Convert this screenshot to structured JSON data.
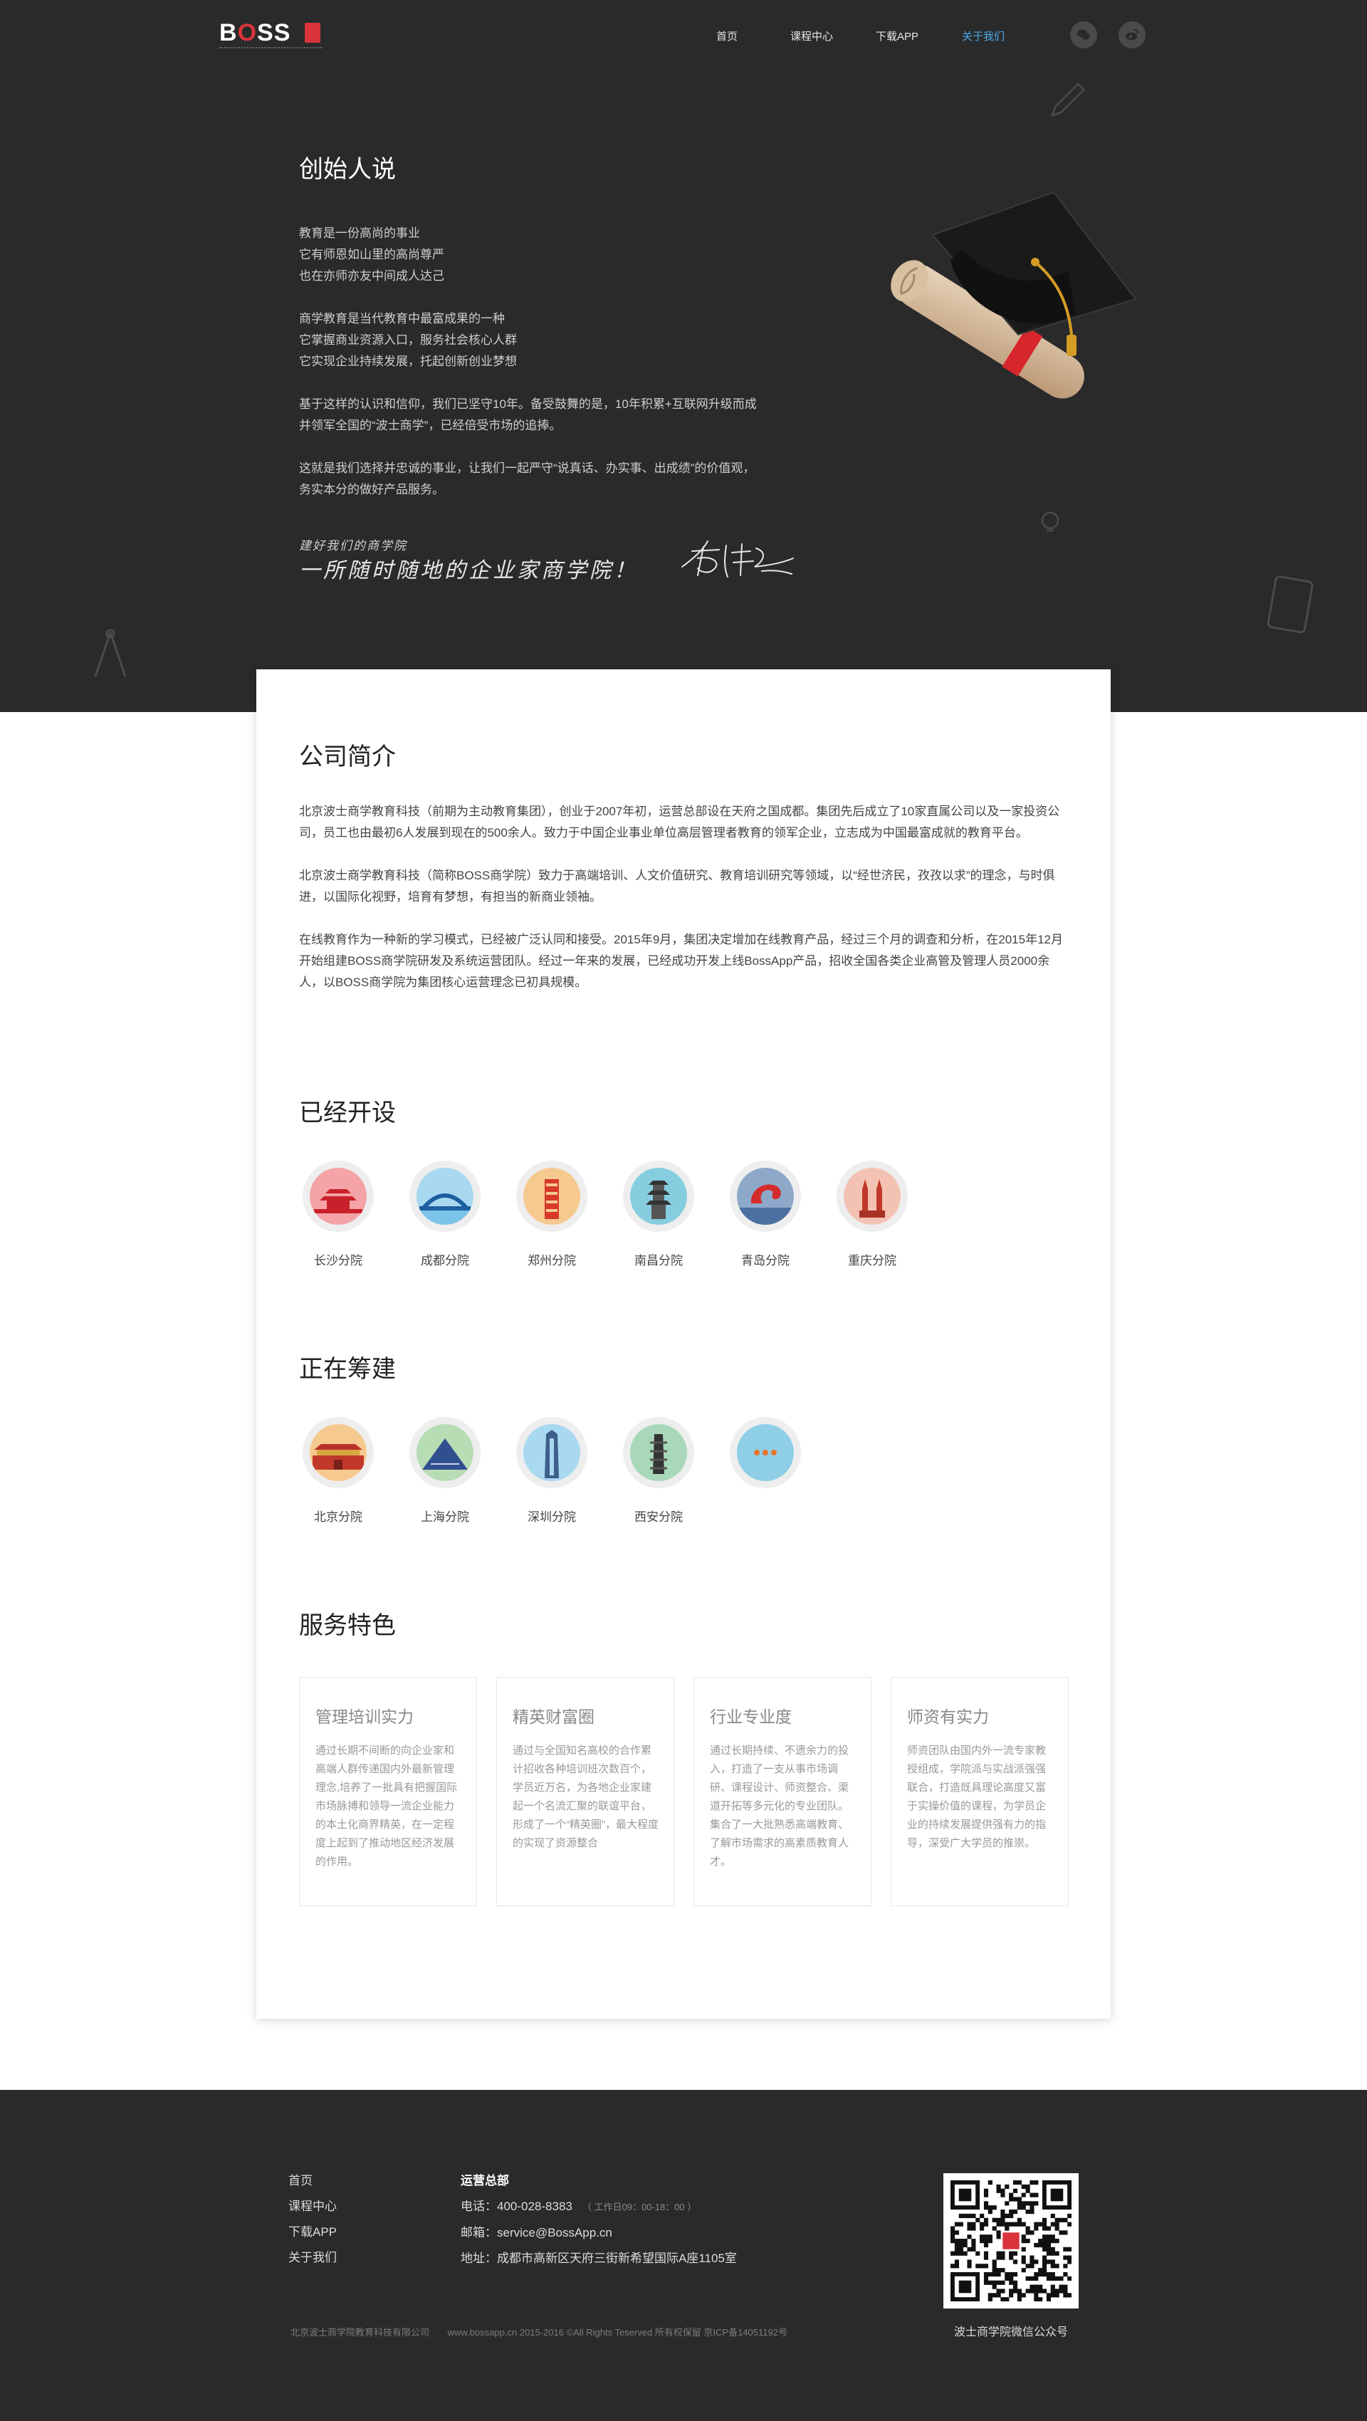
{
  "header": {
    "logo_text": "BOSS",
    "nav": [
      {
        "label": "首页",
        "active": false
      },
      {
        "label": "课程中心",
        "active": false
      },
      {
        "label": "下载APP",
        "active": false
      },
      {
        "label": "关于我们",
        "active": true
      }
    ],
    "social": [
      "wechat-icon",
      "weibo-icon"
    ]
  },
  "founder": {
    "title": "创始人说",
    "paragraphs": [
      "教育是一份高尚的事业\n它有师恩如山里的高尚尊严\n也在亦师亦友中间成人达己",
      "商学教育是当代教育中最富成果的一种\n它掌握商业资源入口，服务社会核心人群\n它实现企业持续发展，托起创新创业梦想",
      "基于这样的认识和信仰，我们已坚守10年。备受鼓舞的是，10年积累+互联网升级而成\n并领军全国的“波士商学”，已经倍受市场的追捧。",
      "这就是我们选择并忠诚的事业，让我们一起严守“说真话、办实事、出成绩”的价值观，\n务实本分的做好产品服务。"
    ],
    "signature_line1": "建好我们的商学院",
    "signature_line2": "一所随时随地的企业家商学院！"
  },
  "company": {
    "title": "公司简介",
    "paragraphs": [
      "北京波士商学教育科技（前期为主动教育集团），创业于2007年初，运营总部设在天府之国成都。集团先后成立了10家直属公司以及一家投资公司，员工也由最初6人发展到现在的500余人。致力于中国企业事业单位高层管理者教育的领军企业，立志成为中国最富成就的教育平台。",
      "北京波士商学教育科技（简称BOSS商学院）致力于高端培训、人文价值研究、教育培训研究等领域，以“经世济民，孜孜以求”的理念，与时俱进，以国际化视野，培育有梦想，有担当的新商业领袖。",
      "在线教育作为一种新的学习模式，已经被广泛认同和接受。2015年9月，集团决定增加在线教育产品，经过三个月的调查和分析，在2015年12月开始组建BOSS商学院研发及系统运营团队。经过一年来的发展，已经成功开发上线BossApp产品，招收全国各类企业高管及管理人员2000余人，以BOSS商学院为集团核心运营理念已初具规模。"
    ]
  },
  "opened": {
    "title": "已经开设",
    "cities": [
      {
        "label": "长沙分院",
        "icon": "changsha-landmark-icon",
        "color": "#f4a3a6"
      },
      {
        "label": "成都分院",
        "icon": "chengdu-landmark-icon",
        "color": "#a9d8f1"
      },
      {
        "label": "郑州分院",
        "icon": "zhengzhou-landmark-icon",
        "color": "#f6c98f"
      },
      {
        "label": "南昌分院",
        "icon": "nanchang-landmark-icon",
        "color": "#86cde0"
      },
      {
        "label": "青岛分院",
        "icon": "qingdao-landmark-icon",
        "color": "#8ea8c9"
      },
      {
        "label": "重庆分院",
        "icon": "chongqing-landmark-icon",
        "color": "#f3c2b2"
      }
    ]
  },
  "building": {
    "title": "正在筹建",
    "cities": [
      {
        "label": "北京分院",
        "icon": "beijing-landmark-icon",
        "color": "#f6c98f"
      },
      {
        "label": "上海分院",
        "icon": "shanghai-landmark-icon",
        "color": "#b8dcb4"
      },
      {
        "label": "深圳分院",
        "icon": "shenzhen-landmark-icon",
        "color": "#a9d8f1"
      },
      {
        "label": "西安分院",
        "icon": "xian-landmark-icon",
        "color": "#a8d8b9"
      },
      {
        "label": "",
        "icon": "more-dots-icon",
        "color": "#8ecfe6"
      }
    ]
  },
  "services": {
    "title": "服务特色",
    "items": [
      {
        "title": "管理培训实力",
        "desc": "通过长期不间断的向企业家和高端人群传递国内外最新管理理念,培养了一批具有把握国际市场脉搏和领导一流企业能力的本土化商界精英，在一定程度上起到了推动地区经济发展的作用。"
      },
      {
        "title": "精英财富圈",
        "desc": "通过与全国知名高校的合作累计招收各种培训班次数百个，学员近万名，为各地企业家建起一个名流汇聚的联谊平台，形成了一个“精英圈”，最大程度的实现了资源整合"
      },
      {
        "title": "行业专业度",
        "desc": "通过长期持续、不遗余力的投入，打造了一支从事市场调研、课程设计、师资整合、渠道开拓等多元化的专业团队。集合了一大批熟悉高端教育、了解市场需求的高素质教育人才。"
      },
      {
        "title": "师资有实力",
        "desc": "师资团队由国内外一流专家教授组成，学院派与实战派强强联合，打造既具理论高度又富于实操价值的课程，为学员企业的持续发展提供强有力的指导，深受广大学员的推崇。"
      }
    ]
  },
  "footer": {
    "nav": [
      "首页",
      "课程中心",
      "下载APP",
      "关于我们"
    ],
    "contact_head": "运营总部",
    "phone": "电话：400-028-8383",
    "hours": "（ 工作日09：00-18：00 ）",
    "email": "邮箱：service@BossApp.cn",
    "address": "地址：成都市高新区天府三街新希望国际A座1105室",
    "company": "北京波士商学院教育科技有限公司",
    "copyright": "www.bossapp.cn  2015-2016  ©All Rights Teserved  所有权保留  京ICP备14051192号",
    "qr_caption": "波士商学院微信公众号"
  }
}
